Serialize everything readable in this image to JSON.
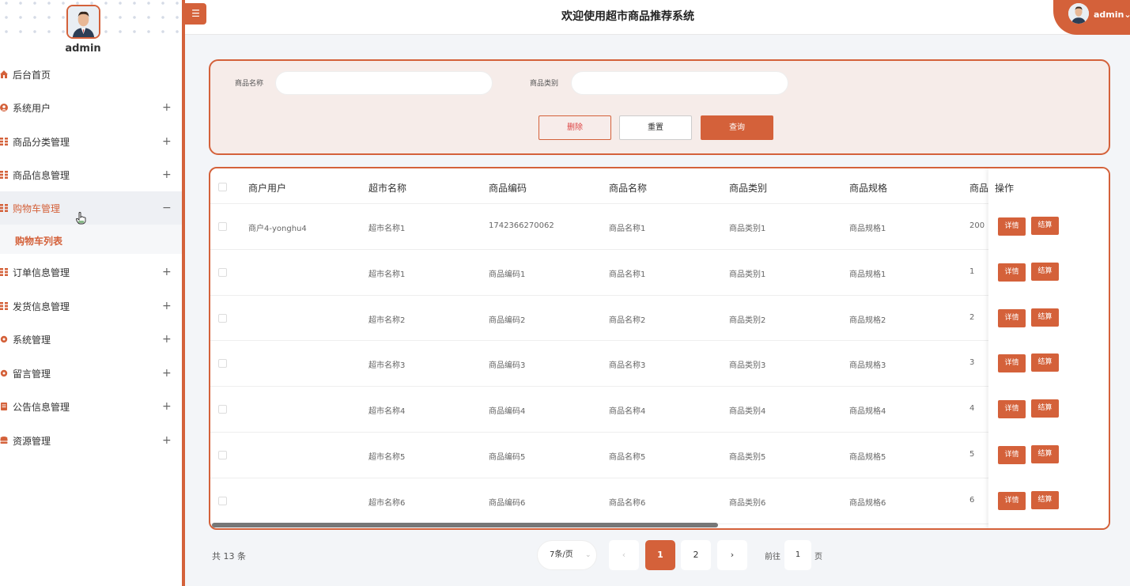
{
  "header": {
    "title": "欢迎使用超市商品推荐系统",
    "user": "admin"
  },
  "sidebar": {
    "username": "admin",
    "items": [
      {
        "label": "后台首页",
        "toggle": "",
        "icon": "home-icon"
      },
      {
        "label": "系统用户",
        "toggle": "+",
        "icon": "user-icon"
      },
      {
        "label": "商品分类管理",
        "toggle": "+",
        "icon": "grid-icon"
      },
      {
        "label": "商品信息管理",
        "toggle": "+",
        "icon": "grid-icon"
      },
      {
        "label": "购物车管理",
        "toggle": "−",
        "icon": "grid-icon"
      },
      {
        "label": "订单信息管理",
        "toggle": "+",
        "icon": "grid-icon"
      },
      {
        "label": "发货信息管理",
        "toggle": "+",
        "icon": "grid-icon"
      },
      {
        "label": "系统管理",
        "toggle": "+",
        "icon": "gear-icon"
      },
      {
        "label": "留言管理",
        "toggle": "+",
        "icon": "gear-icon"
      },
      {
        "label": "公告信息管理",
        "toggle": "+",
        "icon": "notice-icon"
      },
      {
        "label": "资源管理",
        "toggle": "+",
        "icon": "database-icon"
      }
    ],
    "sub_item": "购物车列表",
    "accent": "#d4613a"
  },
  "search": {
    "name_label": "商品名称",
    "category_label": "商品类别",
    "name_value": "",
    "category_value": "",
    "delete": "删除",
    "reset": "重置",
    "query": "查询"
  },
  "table": {
    "headers": [
      "商户用户",
      "超市名称",
      "商品编码",
      "商品名称",
      "商品类别",
      "商品规格",
      "商品",
      "操作"
    ],
    "rows": [
      [
        "商户4-yonghu4",
        "超市名称1",
        "1742366270062",
        "商品名称1",
        "商品类别1",
        "商品规格1",
        "200"
      ],
      [
        "",
        "超市名称1",
        "商品编码1",
        "商品名称1",
        "商品类别1",
        "商品规格1",
        "1"
      ],
      [
        "",
        "超市名称2",
        "商品编码2",
        "商品名称2",
        "商品类别2",
        "商品规格2",
        "2"
      ],
      [
        "",
        "超市名称3",
        "商品编码3",
        "商品名称3",
        "商品类别3",
        "商品规格3",
        "3"
      ],
      [
        "",
        "超市名称4",
        "商品编码4",
        "商品名称4",
        "商品类别4",
        "商品规格4",
        "4"
      ],
      [
        "",
        "超市名称5",
        "商品编码5",
        "商品名称5",
        "商品类别5",
        "商品规格5",
        "5"
      ],
      [
        "",
        "超市名称6",
        "商品编码6",
        "商品名称6",
        "商品类别6",
        "商品规格6",
        "6"
      ]
    ],
    "detail": "详情",
    "checkout": "结算"
  },
  "pagination": {
    "total": "共 13 条",
    "page_size": "7条/页",
    "prev": "‹",
    "pages": [
      "1",
      "2"
    ],
    "next": "›",
    "goto_label": "前往",
    "goto_value": "1",
    "page_unit": "页"
  }
}
